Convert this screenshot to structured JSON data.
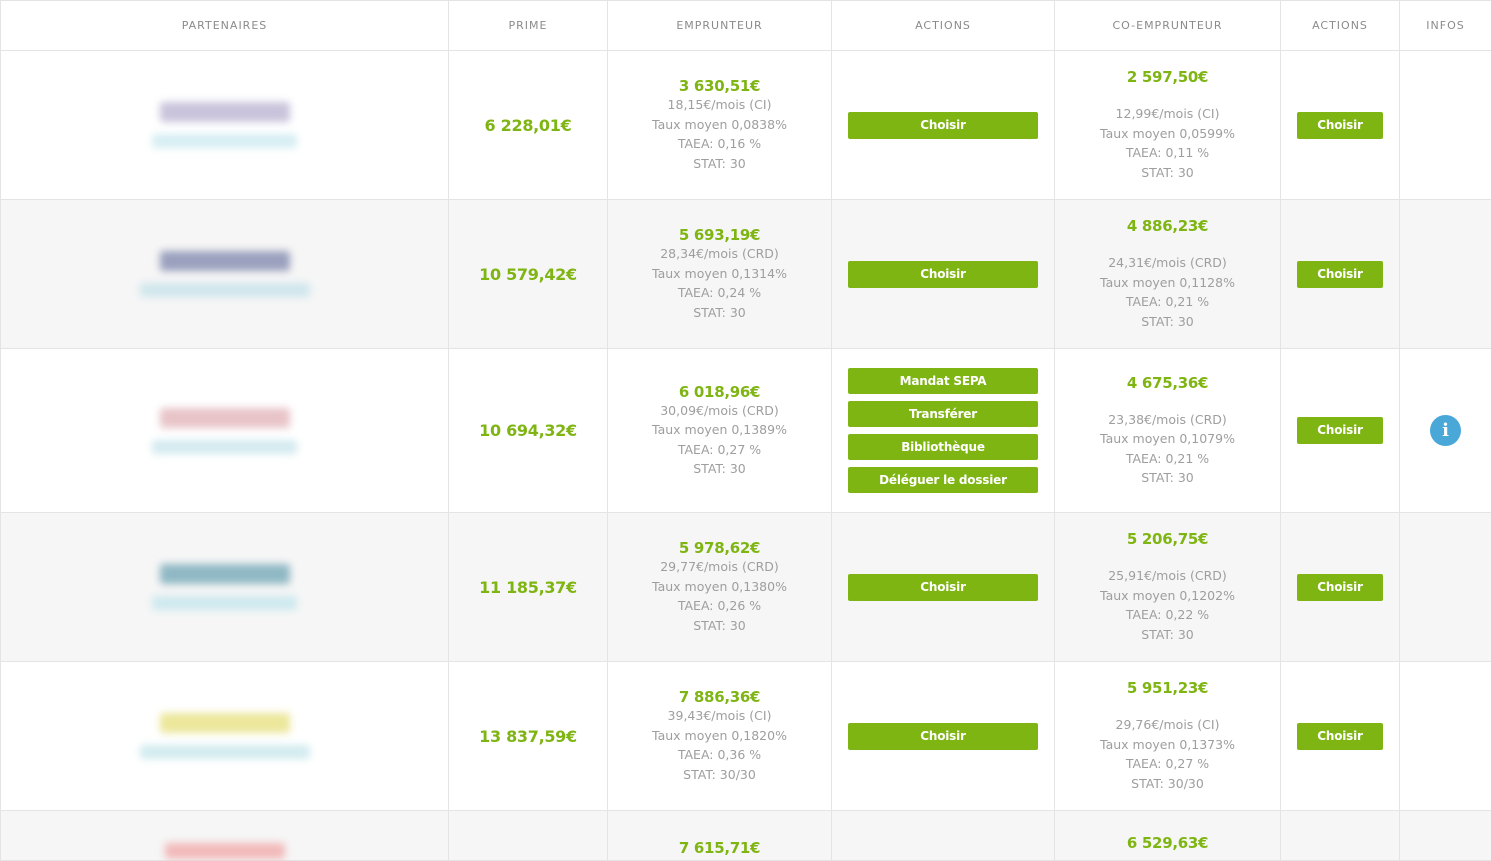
{
  "headers": {
    "partners": "PARTENAIRES",
    "prime": "PRIME",
    "borrower": "EMPRUNTEUR",
    "actions1": "ACTIONS",
    "coborrower": "CO-EMPRUNTEUR",
    "actions2": "ACTIONS",
    "infos": "INFOS"
  },
  "colors": {
    "accent": "#7fb513",
    "info": "#4aa8d8",
    "text": "#9e9e9e",
    "border": "#e4e4e4"
  },
  "icons": {
    "info": "info-icon"
  },
  "rows": [
    {
      "logo": {
        "top": "#c9c3db",
        "bottom": "#d6eef3"
      },
      "prime": "6 228,01€",
      "borrower": {
        "amount": "3 630,51€",
        "monthly": "18,15€/mois (CI)",
        "rate": "Taux moyen 0,0838%",
        "taea": "TAEA: 0,16 %",
        "stat": "STAT: 30"
      },
      "actions1": [
        "Choisir"
      ],
      "coborrower": {
        "amount": "2 597,50€",
        "monthly": "12,99€/mois (CI)",
        "rate": "Taux moyen 0,0599%",
        "taea": "TAEA: 0,11 %",
        "stat": "STAT: 30"
      },
      "actions2": "Choisir",
      "info": false
    },
    {
      "logo": {
        "top": "#9aa0bd",
        "bottom": "#cfe6ec"
      },
      "prime": "10 579,42€",
      "borrower": {
        "amount": "5 693,19€",
        "monthly": "28,34€/mois (CRD)",
        "rate": "Taux moyen 0,1314%",
        "taea": "TAEA: 0,24 %",
        "stat": "STAT: 30"
      },
      "actions1": [
        "Choisir"
      ],
      "coborrower": {
        "amount": "4 886,23€",
        "monthly": "24,31€/mois (CRD)",
        "rate": "Taux moyen 0,1128%",
        "taea": "TAEA: 0,21 %",
        "stat": "STAT: 30"
      },
      "actions2": "Choisir",
      "info": false
    },
    {
      "logo": {
        "top": "#e8c4c8",
        "bottom": "#d3eaf0"
      },
      "prime": "10 694,32€",
      "borrower": {
        "amount": "6 018,96€",
        "monthly": "30,09€/mois (CRD)",
        "rate": "Taux moyen 0,1389%",
        "taea": "TAEA: 0,27 %",
        "stat": "STAT: 30"
      },
      "actions1": [
        "Mandat SEPA",
        "Transférer",
        "Bibliothèque",
        "Déléguer le dossier"
      ],
      "coborrower": {
        "amount": "4 675,36€",
        "monthly": "23,38€/mois (CRD)",
        "rate": "Taux moyen 0,1079%",
        "taea": "TAEA: 0,21 %",
        "stat": "STAT: 30"
      },
      "actions2": "Choisir",
      "info": true
    },
    {
      "logo": {
        "top": "#8fb8c4",
        "bottom": "#cde9ef"
      },
      "prime": "11 185,37€",
      "borrower": {
        "amount": "5 978,62€",
        "monthly": "29,77€/mois (CRD)",
        "rate": "Taux moyen 0,1380%",
        "taea": "TAEA: 0,26 %",
        "stat": "STAT: 30"
      },
      "actions1": [
        "Choisir"
      ],
      "coborrower": {
        "amount": "5 206,75€",
        "monthly": "25,91€/mois (CRD)",
        "rate": "Taux moyen 0,1202%",
        "taea": "TAEA: 0,22 %",
        "stat": "STAT: 30"
      },
      "actions2": "Choisir",
      "info": false
    },
    {
      "logo": {
        "top": "#ece79a",
        "bottom": "#d2ebef"
      },
      "prime": "13 837,59€",
      "borrower": {
        "amount": "7 886,36€",
        "monthly": "39,43€/mois (CI)",
        "rate": "Taux moyen 0,1820%",
        "taea": "TAEA: 0,36 %",
        "stat": "STAT: 30/30"
      },
      "actions1": [
        "Choisir"
      ],
      "coborrower": {
        "amount": "5 951,23€",
        "monthly": "29,76€/mois (CI)",
        "rate": "Taux moyen 0,1373%",
        "taea": "TAEA: 0,27 %",
        "stat": "STAT: 30/30"
      },
      "actions2": "Choisir",
      "info": false
    }
  ],
  "partial_row": {
    "logo": {
      "top": "#f2b9b9"
    },
    "borrower_amount": "7 615,71€",
    "coborrower_amount": "6 529,63€"
  }
}
